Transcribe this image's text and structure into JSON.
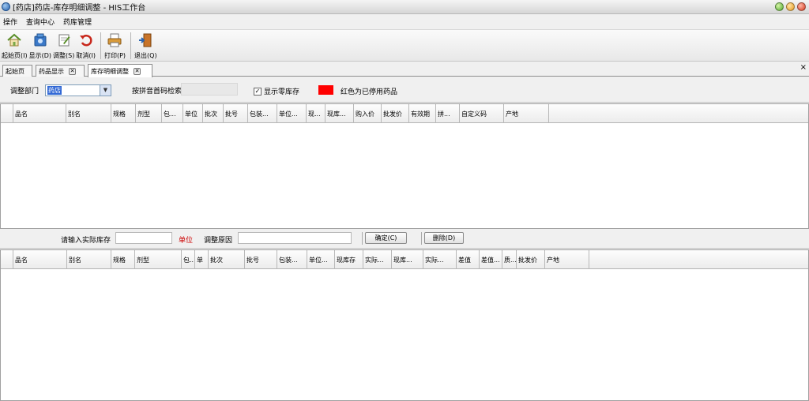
{
  "window": {
    "title": "[药店]药店-库存明细调整 - HIS工作台"
  },
  "menu": [
    "操作",
    "查询中心",
    "药库管理"
  ],
  "toolbar": {
    "items": [
      {
        "label": "起始页(I)",
        "icon": "home-icon"
      },
      {
        "label": "显示(D)",
        "icon": "display-icon"
      },
      {
        "label": "调整(S)",
        "icon": "adjust-icon"
      },
      {
        "label": "取消(I)",
        "icon": "undo-icon"
      },
      {
        "label": "打印(P)",
        "icon": "printer-icon"
      },
      {
        "label": "退出(Q)",
        "icon": "exit-icon"
      }
    ]
  },
  "tabs": [
    {
      "label": "起始页",
      "closable": false
    },
    {
      "label": "药品显示",
      "closable": true
    },
    {
      "label": "库存明细调整",
      "closable": true,
      "active": true
    }
  ],
  "tabstrip_close": "×",
  "filter": {
    "dept_label": "调整部门",
    "dept_value": "药店",
    "name_input_label": "按拼音首码检索",
    "show_zero_label": "显示零库存",
    "show_zero_checked": true,
    "legend_text": "红色为已停用药品",
    "legend_color": "#ff0000"
  },
  "upper_grid": {
    "columns": [
      "品名",
      "别名",
      "规格",
      "剂型",
      "包...",
      "单位",
      "批次",
      "批号",
      "包装...",
      "单位...",
      "现...",
      "现库...",
      "购入价",
      "批发价",
      "有效期",
      "拼...",
      "自定义码",
      "产地"
    ]
  },
  "adjust": {
    "actual_label": "请输入实际库存",
    "unit_label": "单位",
    "reason_label": "调整原因",
    "ok_button": "确定(C)",
    "delete_button": "删除(D)"
  },
  "lower_grid": {
    "columns": [
      "品名",
      "别名",
      "规格",
      "剂型",
      "包...",
      "单",
      "批次",
      "批号",
      "包装...",
      "单位...",
      "现库存",
      "实际...",
      "现库...",
      "实际...",
      "差值",
      "差值...",
      "质...",
      "批发价",
      "产地"
    ]
  },
  "colors": {
    "selection": "#3168d5",
    "unit_label": "#cc0000"
  }
}
